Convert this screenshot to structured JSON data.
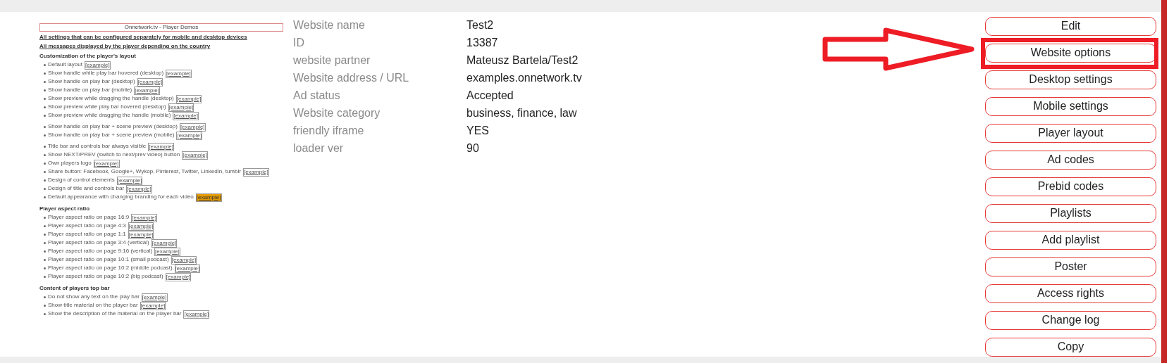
{
  "preview": {
    "title": "Onnetwork.tv - Player Demos",
    "links": [
      "All settings that can be configured separately for mobile and desktop devices",
      "All messages displayed by the player depending on the country"
    ],
    "sections": [
      {
        "heading": "Customization of the player's layout",
        "groups": [
          [
            {
              "text": "Default layout",
              "link": "[example]",
              "highlighted": false
            },
            {
              "text": "Show handle while play bar hovered (desktop)",
              "link": "[example]",
              "highlighted": false
            },
            {
              "text": "Show handle on play bar (desktop)",
              "link": "[example]",
              "highlighted": false
            },
            {
              "text": "Show handle on play bar (mobile)",
              "link": "[example]",
              "highlighted": false
            },
            {
              "text": "Show preview while dragging the handle (desktop)",
              "link": "[example]",
              "highlighted": false
            },
            {
              "text": "Show preview while play bar hovered (desktop)",
              "link": "[example]",
              "highlighted": false
            },
            {
              "text": "Show preview while dragging the handle (mobile)",
              "link": "[example]",
              "highlighted": false
            }
          ],
          [
            {
              "text": "Show handle on play bar + scene preview (desktop)",
              "link": "[example]",
              "highlighted": false
            },
            {
              "text": "Show handle on play bar + scene preview (mobile)",
              "link": "[example]",
              "highlighted": false
            }
          ],
          [
            {
              "text": "Title bar and controls bar always visible",
              "link": "[example]",
              "highlighted": false
            },
            {
              "text": "Show NEXT/PREV (switch to next/prev video) button",
              "link": "[example]",
              "highlighted": false
            },
            {
              "text": "Own players logo",
              "link": "[example]",
              "highlighted": false
            },
            {
              "text": "Share button: Facebook, Google+, Wykop, Pinterest, Twitter, LinkedIn, tumblr",
              "link": "[example]",
              "highlighted": false
            },
            {
              "text": "Design of control elements",
              "link": "[example]",
              "highlighted": false
            },
            {
              "text": "Design of title and controls bar",
              "link": "[example]",
              "highlighted": false
            },
            {
              "text": "Default appearance with changing branding for each video",
              "link": "[example]",
              "highlighted": true
            }
          ]
        ]
      },
      {
        "heading": "Player aspect ratio",
        "groups": [
          [
            {
              "text": "Player aspect ratio on page 16:9",
              "link": "[example]",
              "highlighted": false
            },
            {
              "text": "Player aspect ratio on page 4:3",
              "link": "[example]",
              "highlighted": false
            },
            {
              "text": "Player aspect ratio on page 1:1",
              "link": "[example]",
              "highlighted": false
            },
            {
              "text": "Player aspect ratio on page 3:4 (vertical)",
              "link": "[example]",
              "highlighted": false
            },
            {
              "text": "Player aspect ratio on page 9:16 (vertical)",
              "link": "[example]",
              "highlighted": false
            },
            {
              "text": "Player aspect ratio on page 10:1 (small podcast)",
              "link": "[example]",
              "highlighted": false
            },
            {
              "text": "Player aspect ratio on page 10:2 (middle podcast)",
              "link": "[example]",
              "highlighted": false
            },
            {
              "text": "Player aspect ratio on page 10:2 (big podcast)",
              "link": "[example]",
              "highlighted": false
            }
          ]
        ]
      },
      {
        "heading": "Content of players top bar",
        "groups": [
          [
            {
              "text": "Do not show any text on the play bar",
              "link": "[example]",
              "highlighted": false
            },
            {
              "text": "Show title material on the player bar",
              "link": "[example]",
              "highlighted": false
            },
            {
              "text": "Show the description of the material on the player bar",
              "link": "[example]",
              "highlighted": false
            }
          ]
        ]
      }
    ]
  },
  "details": [
    {
      "label": "Website name",
      "value": "Test2"
    },
    {
      "label": "ID",
      "value": "13387"
    },
    {
      "label": "website partner",
      "value": "Mateusz Bartela/Test2"
    },
    {
      "label": "Website address / URL",
      "value": "examples.onnetwork.tv"
    },
    {
      "label": "Ad status",
      "value": "Accepted"
    },
    {
      "label": "Website category",
      "value": "business, finance, law"
    },
    {
      "label": "friendly iframe",
      "value": "YES"
    },
    {
      "label": "loader ver",
      "value": "90"
    }
  ],
  "actions": [
    {
      "label": "Edit",
      "highlighted": false
    },
    {
      "label": "Website options",
      "highlighted": true
    },
    {
      "label": "Desktop settings",
      "highlighted": false
    },
    {
      "label": "Mobile settings",
      "highlighted": false
    },
    {
      "label": "Player layout",
      "highlighted": false
    },
    {
      "label": "Ad codes",
      "highlighted": false
    },
    {
      "label": "Prebid codes",
      "highlighted": false
    },
    {
      "label": "Playlists",
      "highlighted": false
    },
    {
      "label": "Add playlist",
      "highlighted": false
    },
    {
      "label": "Poster",
      "highlighted": false
    },
    {
      "label": "Access rights",
      "highlighted": false
    },
    {
      "label": "Change log",
      "highlighted": false
    },
    {
      "label": "Copy",
      "highlighted": false
    }
  ]
}
